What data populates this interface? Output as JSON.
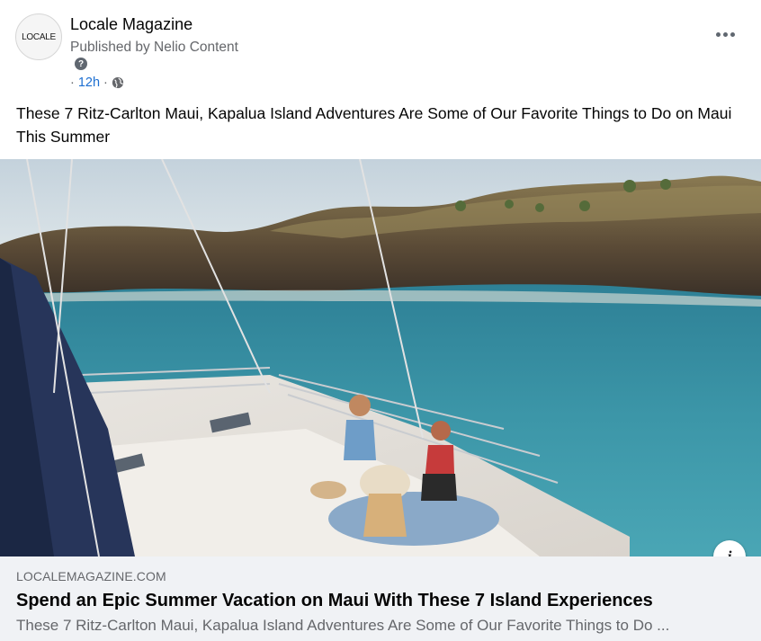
{
  "post": {
    "page_name": "Locale Magazine",
    "avatar_text": "LOCALE",
    "published_by": "Published by Nelio Content",
    "help_icon": "question-circle-icon",
    "time_prefix": "·",
    "time": "12h",
    "time_suffix": "·",
    "privacy_icon": "globe-icon",
    "more_icon": "more-horizontal-icon",
    "text": "These 7 Ritz-Carlton Maui, Kapalua Island Adventures Are Some of Our Favorite Things to Do on Maui This Summer"
  },
  "link_preview": {
    "domain": "LOCALEMAGAZINE.COM",
    "title": "Spend an Epic Summer Vacation on Maui With These 7 Island Experiences",
    "description": "These 7 Ritz-Carlton Maui, Kapalua Island Adventures Are Some of Our Favorite Things to Do ...",
    "info_icon": "info-icon",
    "info_label": "i"
  },
  "colors": {
    "link_blue": "#1d6fd1",
    "secondary_text": "#65676b",
    "preview_bg": "#f0f2f5"
  }
}
